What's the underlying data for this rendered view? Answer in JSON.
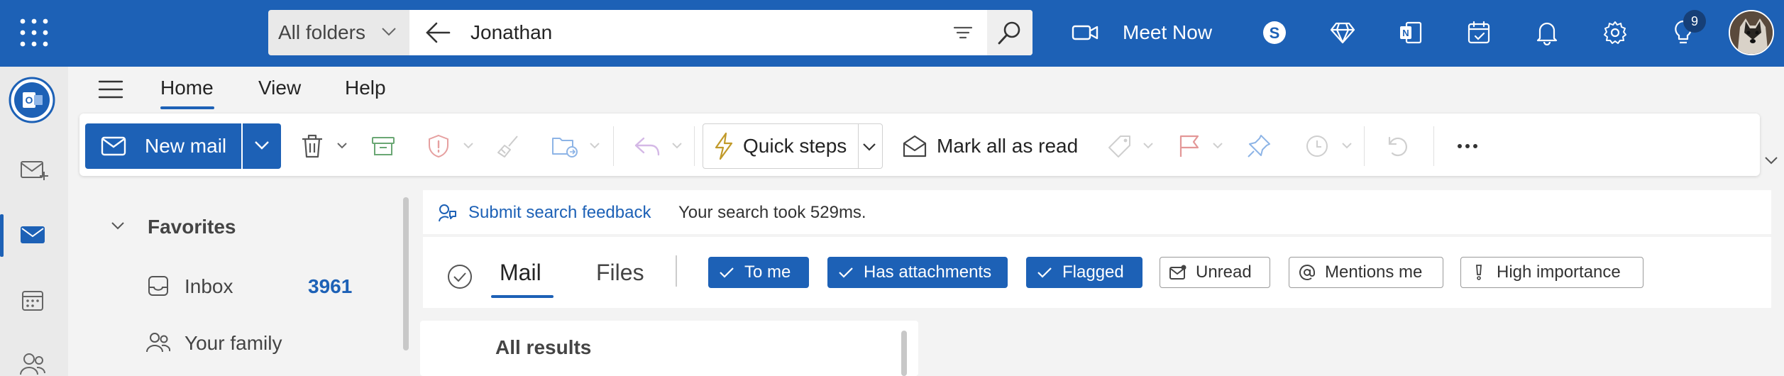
{
  "header": {
    "scope": "All folders",
    "search_value": "Jonathan",
    "meet_now": "Meet Now",
    "notification_badge": "9",
    "brand_color": "#1d61b6"
  },
  "nav_tabs": [
    {
      "label": "Home",
      "active": true
    },
    {
      "label": "View"
    },
    {
      "label": "Help"
    }
  ],
  "ribbon": {
    "new_mail": "New mail",
    "quick_steps": "Quick steps",
    "mark_all_read": "Mark all as read",
    "icons": [
      "delete-icon",
      "archive-icon",
      "report-icon",
      "sweep-icon",
      "move-to-icon",
      "reply-icon",
      "tag-icon",
      "flag-icon",
      "pin-icon",
      "snooze-icon",
      "undo-icon",
      "more-icon"
    ]
  },
  "folders": {
    "favorites": "Favorites",
    "items": [
      {
        "label": "Inbox",
        "count": "3961"
      },
      {
        "label": "Your family"
      }
    ]
  },
  "search_panel": {
    "feedback_link": "Submit search feedback",
    "timing": "Your search took 529ms.",
    "tabs": [
      {
        "label": "Mail",
        "active": true
      },
      {
        "label": "Files"
      }
    ],
    "filters": [
      {
        "label": "To me",
        "on": true
      },
      {
        "label": "Has attachments",
        "on": true
      },
      {
        "label": "Flagged",
        "on": true
      },
      {
        "label": "Unread",
        "on": false
      },
      {
        "label": "Mentions me",
        "on": false
      },
      {
        "label": "High importance",
        "on": false
      }
    ],
    "results_header": "All results"
  }
}
